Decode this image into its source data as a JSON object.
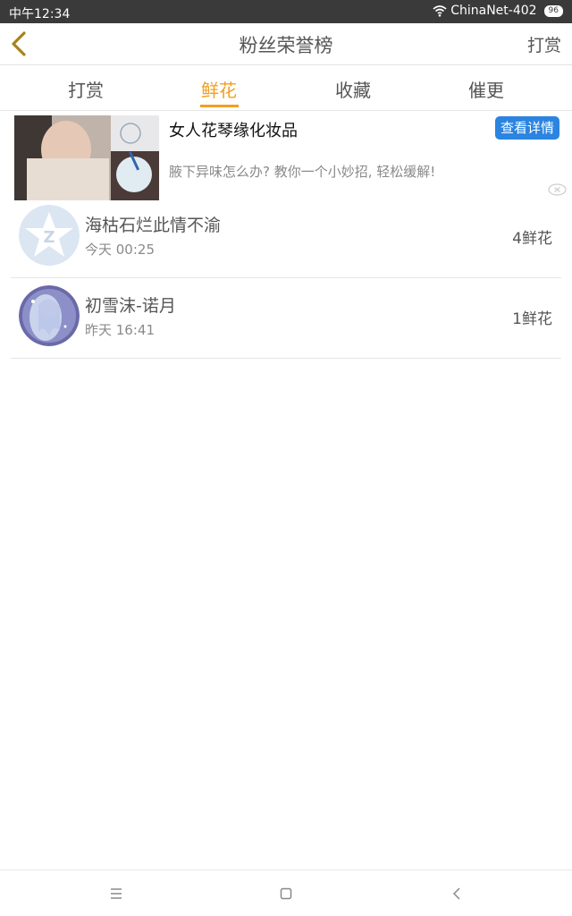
{
  "status_bar": {
    "time": "中午12:34",
    "network": "ChinaNet-402",
    "battery": "96"
  },
  "header": {
    "title": "粉丝荣誉榜",
    "action_label": "打赏"
  },
  "tabs": [
    {
      "label": "打赏",
      "active": false
    },
    {
      "label": "鲜花",
      "active": true
    },
    {
      "label": "收藏",
      "active": false
    },
    {
      "label": "催更",
      "active": false
    }
  ],
  "ad": {
    "title": "女人花琴缘化妆品",
    "description": "腋下异味怎么办? 教你一个小妙招, 轻松缓解!",
    "button_label": "查看详情"
  },
  "fans": [
    {
      "name": "海枯石烂此情不渝",
      "time": "今天 00:25",
      "count": "4鲜花",
      "avatar": "default-qq-avatar"
    },
    {
      "name": "初雪沫-诺月",
      "time": "昨天 16:41",
      "count": "1鲜花",
      "avatar": "anime-girl-avatar"
    }
  ],
  "colors": {
    "accent": "#f0a020",
    "ad_button": "#2a84e0",
    "status_bar": "#3a3a3a"
  },
  "nav": {
    "menu_icon": "menu-icon",
    "home_icon": "home-icon",
    "back_icon": "back-icon"
  }
}
